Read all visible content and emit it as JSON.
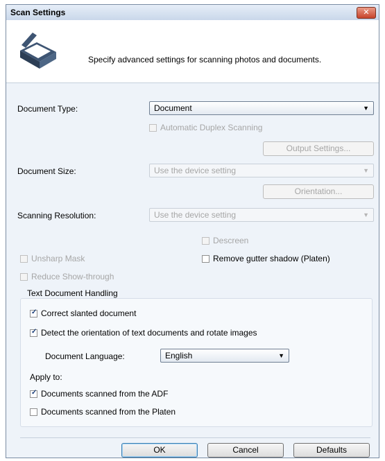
{
  "window": {
    "title": "Scan Settings",
    "close_glyph": "✕"
  },
  "header": {
    "icon": "scanner-icon",
    "description": "Specify advanced settings for scanning photos and documents."
  },
  "document_type": {
    "label": "Document Type:",
    "value": "Document"
  },
  "automatic_duplex": {
    "label": "Automatic Duplex Scanning",
    "checked": false,
    "enabled": false
  },
  "output_settings": {
    "label": "Output Settings..."
  },
  "document_size": {
    "label": "Document Size:",
    "value": "Use the device setting"
  },
  "orientation": {
    "label": "Orientation..."
  },
  "scanning_resolution": {
    "label": "Scanning Resolution:",
    "value": "Use the device setting"
  },
  "descreen": {
    "label": "Descreen",
    "checked": false,
    "enabled": false
  },
  "unsharp_mask": {
    "label": "Unsharp Mask",
    "checked": false,
    "enabled": false
  },
  "remove_gutter": {
    "label": "Remove gutter shadow (Platen)",
    "checked": false,
    "enabled": true
  },
  "reduce_show_through": {
    "label": "Reduce Show-through",
    "checked": false,
    "enabled": false
  },
  "text_handling": {
    "title": "Text Document Handling",
    "correct_slanted": {
      "label": "Correct slanted document",
      "checked": true
    },
    "detect_orientation": {
      "label": "Detect the orientation of text documents and rotate images",
      "checked": true
    },
    "language": {
      "label": "Document Language:",
      "value": "English"
    },
    "apply_to": "Apply to:",
    "adf": {
      "label": "Documents scanned from the ADF",
      "checked": true
    },
    "platen": {
      "label": "Documents scanned from the Platen",
      "checked": false
    }
  },
  "buttons": {
    "ok": "OK",
    "cancel": "Cancel",
    "defaults": "Defaults"
  },
  "colors": {
    "title_bar": "#c9d7ea",
    "close_button": "#c7432b",
    "panel": "#eef3f9"
  }
}
